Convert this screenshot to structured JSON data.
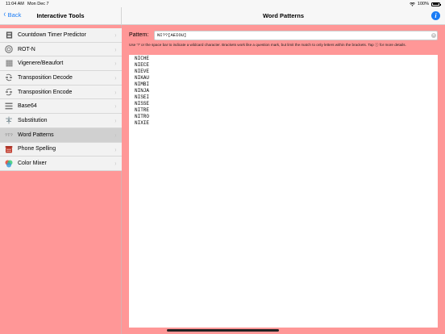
{
  "status": {
    "time": "11:04 AM",
    "date": "Mon Dec 7",
    "battery": "100%"
  },
  "left_nav": {
    "back_label": "Back",
    "title": "Interactive Tools"
  },
  "right_nav": {
    "title": "Word Patterns"
  },
  "sidebar": {
    "items": [
      {
        "label": "Countdown Timer Predictor",
        "icon": "timer-icon"
      },
      {
        "label": "ROT-N",
        "icon": "rot-icon"
      },
      {
        "label": "Vigenere/Beaufort",
        "icon": "grid-icon"
      },
      {
        "label": "Transposition Decode",
        "icon": "transpose-decode-icon"
      },
      {
        "label": "Transposition Encode",
        "icon": "transpose-encode-icon"
      },
      {
        "label": "Base64",
        "icon": "base64-icon"
      },
      {
        "label": "Substitution",
        "icon": "substitution-icon"
      },
      {
        "label": "Word Patterns",
        "icon": "word-pattern-icon",
        "selected": true
      },
      {
        "label": "Phone Spelling",
        "icon": "phone-icon"
      },
      {
        "label": "Color Mixer",
        "icon": "color-wheel-icon"
      }
    ]
  },
  "pattern": {
    "label": "Pattern:",
    "value": "NI??[AEIOU]"
  },
  "hint": "Use '?' or the space bar to indicate a wildcard character. Brackets work like a question mark, but limit the match to only letters within the brackets. Tap ⓘ for more details.",
  "results": [
    "NICHE",
    "NIECE",
    "NIEVE",
    "NIKAU",
    "NIMBI",
    "NINJA",
    "NISEI",
    "NISSE",
    "NITRE",
    "NITRO",
    "NIXIE"
  ],
  "colors": {
    "accent": "#1a7cf5",
    "background": "#ff9797"
  }
}
